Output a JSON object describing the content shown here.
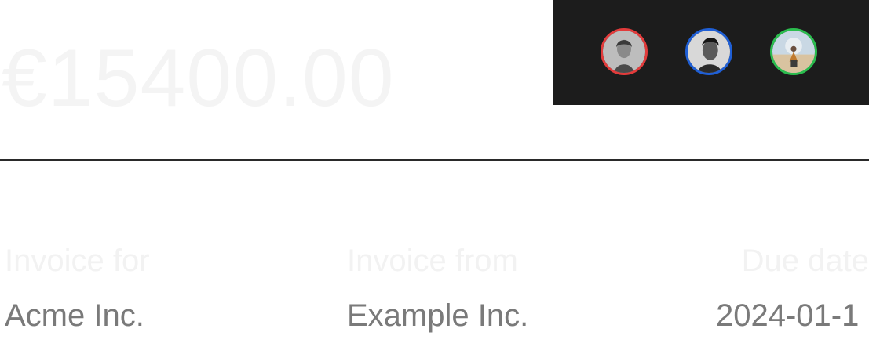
{
  "invoice": {
    "amount": "€15400.00"
  },
  "avatars": {
    "items": [
      {
        "name": "avatar-1",
        "ring_color": "#e23b3b"
      },
      {
        "name": "avatar-2",
        "ring_color": "#1f5fd6"
      },
      {
        "name": "avatar-3",
        "ring_color": "#2bbd4e"
      }
    ]
  },
  "details": {
    "invoice_for_label": "Invoice for",
    "invoice_for_value": "Acme Inc.",
    "invoice_from_label": "Invoice from",
    "invoice_from_value": "Example Inc.",
    "due_date_label": "Due date",
    "due_date_value": "2024-01-1"
  },
  "colors": {
    "panel_background": "#1c1c1c",
    "divider": "#2a2a2a",
    "label_text": "#f2f2f2",
    "value_text": "#7a7a7a"
  }
}
